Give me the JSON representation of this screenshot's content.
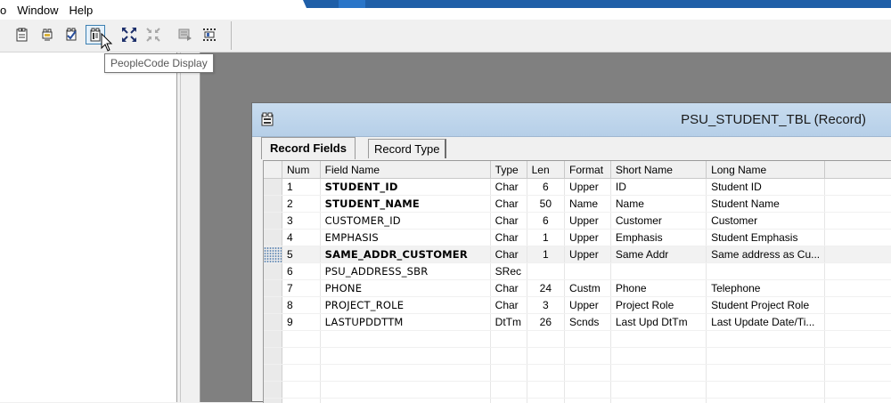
{
  "menu": [
    "o",
    "Window",
    "Help"
  ],
  "toolbar": {
    "buttons": [
      {
        "icon": "record-view-icon"
      },
      {
        "icon": "field-link-icon"
      },
      {
        "icon": "checkmark-validate-icon"
      },
      {
        "icon": "peoplecode-display-icon",
        "active": true
      },
      {
        "icon": "expand-all-icon"
      },
      {
        "icon": "collapse-all-icon"
      },
      {
        "icon": "build-icon"
      },
      {
        "icon": "grid-settings-icon"
      }
    ],
    "tooltip": "PeopleCode Display"
  },
  "record_window": {
    "title": "PSU_STUDENT_TBL (Record)",
    "tabs": [
      "Record Fields",
      "Record Type"
    ],
    "active_tab": "Record Fields",
    "columns": [
      "Num",
      "Field Name",
      "Type",
      "Len",
      "Format",
      "Short Name",
      "Long Name"
    ],
    "rows": [
      {
        "num": "1",
        "field": "STUDENT_ID",
        "type": "Char",
        "len": "6",
        "format": "Upper",
        "short": "ID",
        "long": "Student ID",
        "bold": true
      },
      {
        "num": "2",
        "field": "STUDENT_NAME",
        "type": "Char",
        "len": "50",
        "format": "Name",
        "short": "Name",
        "long": "Student Name",
        "bold": true
      },
      {
        "num": "3",
        "field": "CUSTOMER_ID",
        "type": "Char",
        "len": "6",
        "format": "Upper",
        "short": "Customer",
        "long": "Customer",
        "bold": false
      },
      {
        "num": "4",
        "field": "EMPHASIS",
        "type": "Char",
        "len": "1",
        "format": "Upper",
        "short": "Emphasis",
        "long": "Student Emphasis",
        "bold": false
      },
      {
        "num": "5",
        "field": "SAME_ADDR_CUSTOMER",
        "type": "Char",
        "len": "1",
        "format": "Upper",
        "short": "Same Addr",
        "long": "Same address as Cu...",
        "bold": true,
        "current": true
      },
      {
        "num": "6",
        "field": "PSU_ADDRESS_SBR",
        "type": "SRec",
        "len": "",
        "format": "",
        "short": "",
        "long": "",
        "bold": false
      },
      {
        "num": "7",
        "field": "PHONE",
        "type": "Char",
        "len": "24",
        "format": "Custm",
        "short": "Phone",
        "long": "Telephone",
        "bold": false
      },
      {
        "num": "8",
        "field": "PROJECT_ROLE",
        "type": "Char",
        "len": "3",
        "format": "Upper",
        "short": "Project Role",
        "long": "Student Project Role",
        "bold": false
      },
      {
        "num": "9",
        "field": "LASTUPDDTTM",
        "type": "DtTm",
        "len": "26",
        "format": "Scnds",
        "short": "Last Upd DtTm",
        "long": "Last Update Date/Ti...",
        "bold": false
      }
    ],
    "empty_rows": 5
  }
}
